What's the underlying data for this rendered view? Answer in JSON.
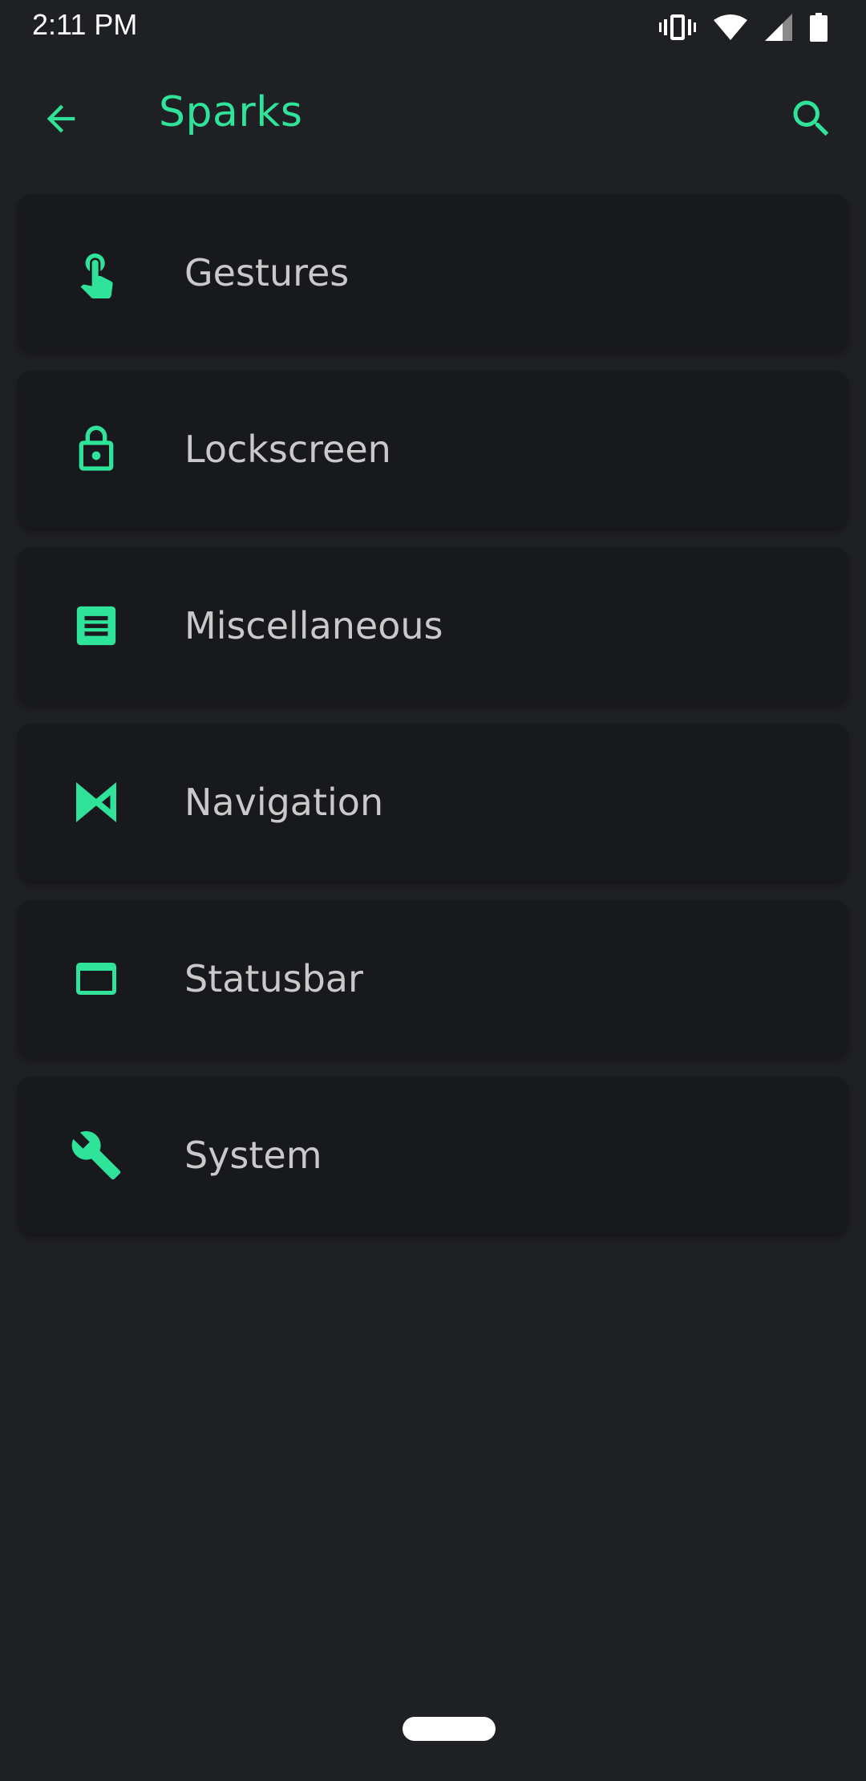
{
  "status_bar": {
    "time": "2:11 PM",
    "icons": [
      "vibrate-icon",
      "wifi-icon",
      "signal-icon",
      "battery-icon"
    ]
  },
  "app_bar": {
    "back_icon": "arrow-left-icon",
    "title": "Sparks",
    "search_icon": "search-icon"
  },
  "menu": {
    "items": [
      {
        "label": "Gestures",
        "icon": "touch-app-icon"
      },
      {
        "label": "Lockscreen",
        "icon": "lock-icon"
      },
      {
        "label": "Miscellaneous",
        "icon": "document-icon"
      },
      {
        "label": "Navigation",
        "icon": "navigation-icon"
      },
      {
        "label": "Statusbar",
        "icon": "window-icon"
      },
      {
        "label": "System",
        "icon": "wrench-icon"
      }
    ]
  },
  "colors": {
    "accent": "#2fe39a",
    "background": "#1f2024",
    "card": "#18191c",
    "label": "#c9c9c9"
  }
}
